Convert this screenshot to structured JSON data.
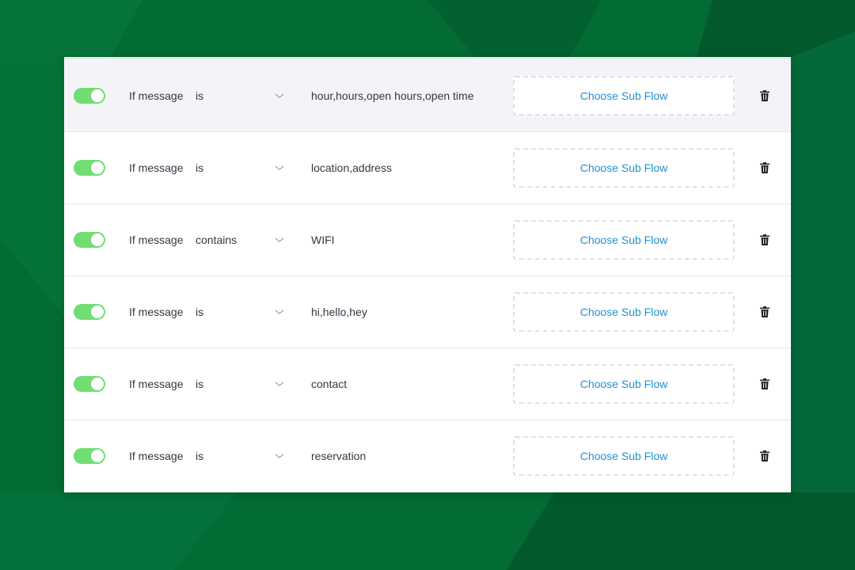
{
  "colors": {
    "background": "#036b34",
    "toggle_on": "#72dd72",
    "link": "#2390cf",
    "text": "#333843",
    "highlight_row": "#f4f4f8"
  },
  "rules": [
    {
      "enabled": true,
      "condition_label": "If message",
      "operator": "is",
      "value": "hour,hours,open hours,open time",
      "subflow_label": "Choose Sub Flow",
      "delete_icon": "trash-icon"
    },
    {
      "enabled": true,
      "condition_label": "If message",
      "operator": "is",
      "value": "location,address",
      "subflow_label": "Choose Sub Flow",
      "delete_icon": "trash-icon"
    },
    {
      "enabled": true,
      "condition_label": "If message",
      "operator": "contains",
      "value": "WIFI",
      "subflow_label": "Choose Sub Flow",
      "delete_icon": "trash-icon"
    },
    {
      "enabled": true,
      "condition_label": "If message",
      "operator": "is",
      "value": "hi,hello,hey",
      "subflow_label": "Choose Sub Flow",
      "delete_icon": "trash-icon"
    },
    {
      "enabled": true,
      "condition_label": "If message",
      "operator": "is",
      "value": "contact",
      "subflow_label": "Choose Sub Flow",
      "delete_icon": "trash-icon"
    },
    {
      "enabled": true,
      "condition_label": "If message",
      "operator": "is",
      "value": "reservation",
      "subflow_label": "Choose Sub Flow",
      "delete_icon": "trash-icon"
    }
  ]
}
